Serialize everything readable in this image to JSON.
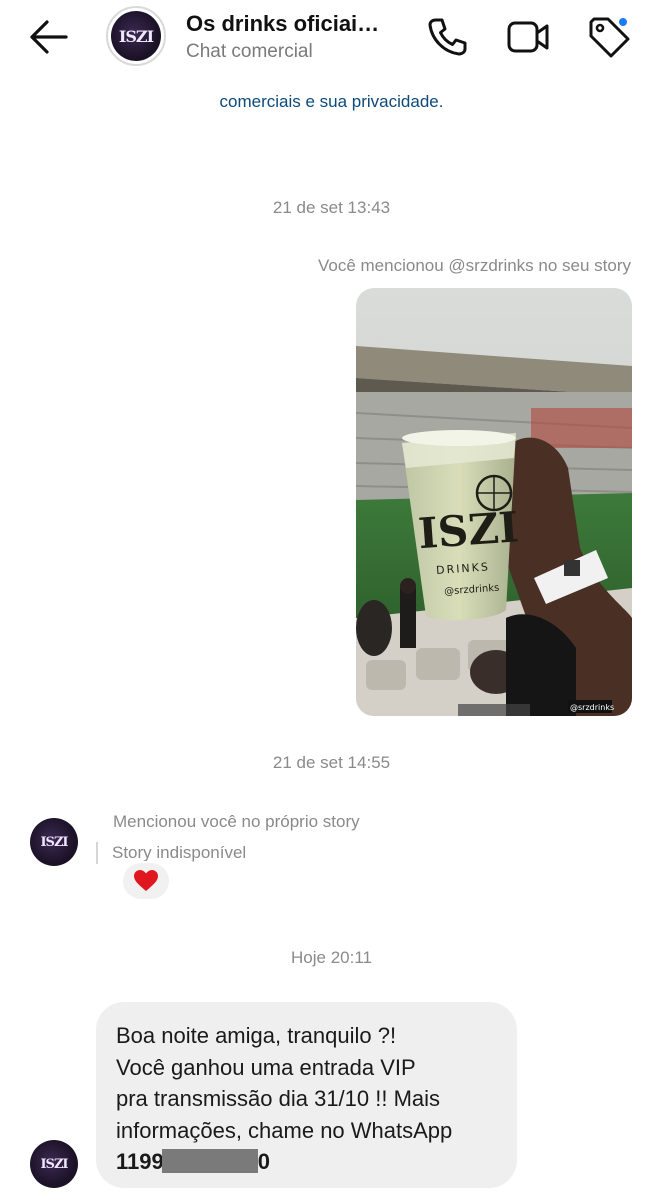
{
  "header": {
    "title": "Os drinks oficiai…",
    "subtitle": "Chat comercial",
    "logo_text": "ISZI",
    "colors": {
      "tag_dot": "#1d7cf2"
    }
  },
  "notice": {
    "text": "comerciais e sua privacidade."
  },
  "messages": {
    "timestamp_1": "21 de set 13:43",
    "outgoing_mention": "Você mencionou @srzdrinks no seu story",
    "story_cup_brand": "ISZI",
    "story_cup_sub": "DRINKS",
    "story_cup_handle": "@srzdrinks",
    "story_watermark": "@srzdrinks",
    "timestamp_2": "21 de set 14:55",
    "incoming_mention": "Mencionou você no próprio story",
    "story_unavailable": "Story indisponível",
    "reaction": "❤️",
    "timestamp_3": "Hoje 20:11",
    "bubble_lines": [
      "Boa noite amiga, tranquilo ?!",
      "Você ganhou uma entrada VIP",
      "pra transmissão dia 31/10 !! Mais",
      "informações, chame no WhatsApp"
    ],
    "phone_prefix": "1199",
    "phone_suffix": "0"
  },
  "icons": [
    "back-arrow-icon",
    "phone-icon",
    "video-icon",
    "tag-icon",
    "heart-icon"
  ]
}
